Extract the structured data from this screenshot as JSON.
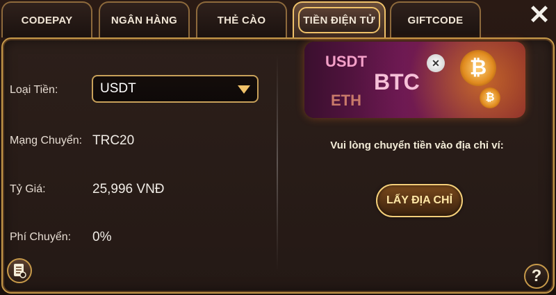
{
  "tabs": [
    {
      "label": "CODEPAY"
    },
    {
      "label": "NGÂN HÀNG"
    },
    {
      "label": "THẺ CÀO"
    },
    {
      "label": "TIỀN ĐIỆN TỬ"
    },
    {
      "label": "GIFTCODE"
    }
  ],
  "close_icon": "close-icon",
  "form": {
    "currency": {
      "label": "Loại Tiền:",
      "value": "USDT"
    },
    "network": {
      "label": "Mạng Chuyển:",
      "value": "TRC20"
    },
    "rate": {
      "label": "Tỷ Giá:",
      "value": "25,996 VNĐ"
    },
    "fee": {
      "label": "Phí Chuyển:",
      "value": "0%"
    }
  },
  "banner": {
    "text1": "USDT",
    "text2": "BTC",
    "text3": "ETH"
  },
  "instruction": "Vui lòng chuyển tiền vào địa chỉ ví:",
  "get_address_button": "LẤY ĐỊA CHỈ",
  "colors": {
    "accent": "#f0c26a",
    "background": "#241915"
  }
}
